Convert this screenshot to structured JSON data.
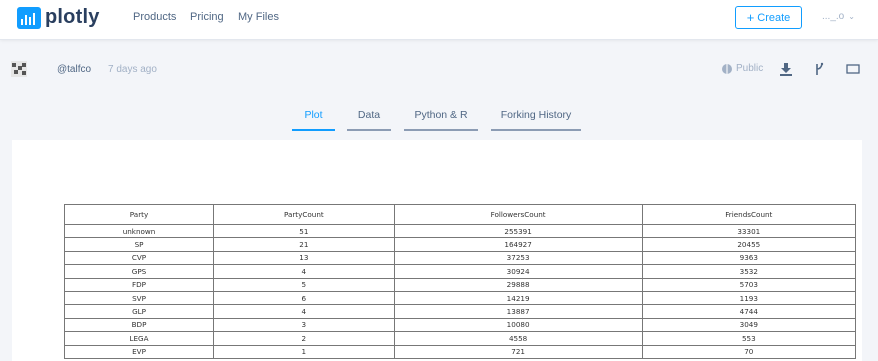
{
  "nav": {
    "logo_text": "plotly",
    "links": [
      "Products",
      "Pricing",
      "My Files"
    ],
    "create_label": "Create",
    "user_label": "..._.о"
  },
  "meta": {
    "username": "@talfco",
    "time_ago": "7 days ago",
    "visibility": "Public"
  },
  "tabs": [
    {
      "label": "Plot",
      "active": true
    },
    {
      "label": "Data",
      "active": false
    },
    {
      "label": "Python & R",
      "active": false
    },
    {
      "label": "Forking History",
      "active": false
    }
  ],
  "table": {
    "headers": [
      "Party",
      "PartyCount",
      "FollowersCount",
      "FriendsCount"
    ],
    "rows": [
      [
        "unknown",
        "51",
        "255391",
        "33301"
      ],
      [
        "SP",
        "21",
        "164927",
        "20455"
      ],
      [
        "CVP",
        "13",
        "37253",
        "9363"
      ],
      [
        "GPS",
        "4",
        "30924",
        "3532"
      ],
      [
        "FDP",
        "5",
        "29888",
        "5703"
      ],
      [
        "SVP",
        "6",
        "14219",
        "1193"
      ],
      [
        "GLP",
        "4",
        "13887",
        "4744"
      ],
      [
        "BDP",
        "3",
        "10080",
        "3049"
      ],
      [
        "LEGA",
        "2",
        "4558",
        "553"
      ],
      [
        "EVP",
        "1",
        "721",
        "70"
      ]
    ]
  },
  "colors": {
    "accent": "#119dff",
    "text": "#506784",
    "muted": "#a2b1c6",
    "tab_underline": "#8c9cb4"
  }
}
